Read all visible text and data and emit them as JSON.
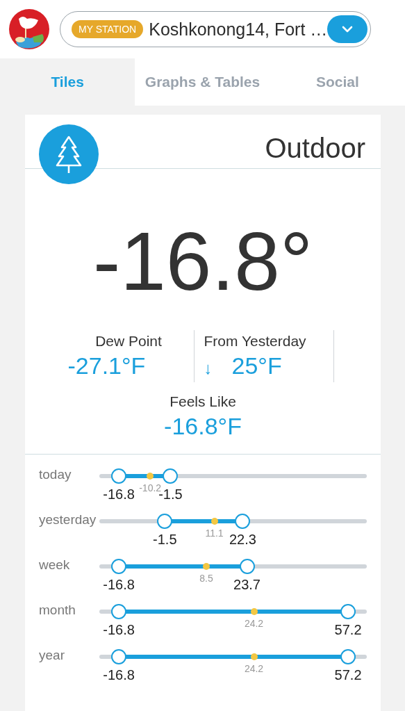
{
  "header": {
    "badge": "MY STATION",
    "station": "Koshkonong14, Fort …"
  },
  "tabs": [
    {
      "label": "Tiles",
      "selected": true
    },
    {
      "label": "Graphs & Tables",
      "selected": false
    },
    {
      "label": "Social",
      "selected": false
    }
  ],
  "card": {
    "title": "Outdoor",
    "temperature": "-16.8°",
    "stats": [
      {
        "label": "Dew Point",
        "value": "-27.1°F"
      },
      {
        "label": "From Yesterday",
        "trend": "↓",
        "value": "25°F"
      }
    ],
    "feels_like": {
      "label": "Feels Like",
      "value": "-16.8°F"
    },
    "ranges": [
      {
        "label": "today",
        "low": {
          "value": "-16.8",
          "level": 0.073
        },
        "avg": {
          "value": "-10.2",
          "level": 0.19
        },
        "high": {
          "value": "-1.5",
          "level": 0.266
        }
      },
      {
        "label": "yesterday",
        "low": {
          "value": "-1.5",
          "level": 0.245
        },
        "avg": {
          "value": "11.1",
          "level": 0.43
        },
        "high": {
          "value": "22.3",
          "level": 0.536
        }
      },
      {
        "label": "week",
        "low": {
          "value": "-16.8",
          "level": 0.073
        },
        "avg": {
          "value": "8.5",
          "level": 0.4
        },
        "high": {
          "value": "23.7",
          "level": 0.552
        }
      },
      {
        "label": "month",
        "low": {
          "value": "-16.8",
          "level": 0.073
        },
        "avg": {
          "value": "24.2",
          "level": 0.578
        },
        "high": {
          "value": "57.2",
          "level": 0.93
        }
      },
      {
        "label": "year",
        "low": {
          "value": "-16.8",
          "level": 0.073
        },
        "avg": {
          "value": "24.2",
          "level": 0.578
        },
        "high": {
          "value": "57.2",
          "level": 0.93
        }
      }
    ]
  }
}
